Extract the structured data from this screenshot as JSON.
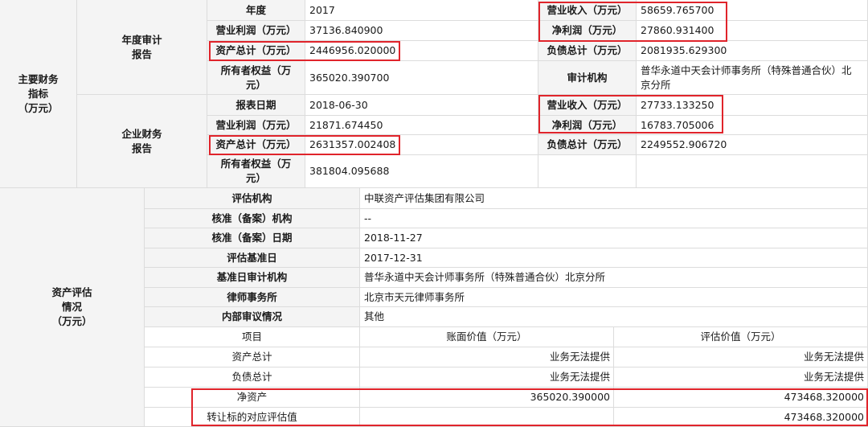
{
  "section_main": "主要财务\n指标\n（万元）",
  "annual": {
    "group": "年度审计\n报告",
    "year_label": "年度",
    "year": "2017",
    "revenue_label": "营业收入（万元）",
    "revenue": "58659.765700",
    "op_profit_label": "营业利润（万元）",
    "op_profit": "37136.840900",
    "net_profit_label": "净利润（万元）",
    "net_profit": "27860.931400",
    "assets_label": "资产总计（万元）",
    "assets": "2446956.020000",
    "liab_label": "负债总计（万元）",
    "liab": "2081935.629300",
    "equity_label": "所有者权益（万\n元）",
    "equity": "365020.390700",
    "auditor_label": "审计机构",
    "auditor": "普华永道中天会计师事务所（特殊普通合伙）北\n京分所"
  },
  "enterprise": {
    "group": "企业财务\n报告",
    "date_label": "报表日期",
    "date": "2018-06-30",
    "revenue_label": "营业收入（万元）",
    "revenue": "27733.133250",
    "op_profit_label": "营业利润（万元）",
    "op_profit": "21871.674450",
    "net_profit_label": "净利润（万元）",
    "net_profit": "16783.705006",
    "assets_label": "资产总计（万元）",
    "assets": "2631357.002408",
    "liab_label": "负债总计（万元）",
    "liab": "2249552.906720",
    "equity_label": "所有者权益（万\n元）",
    "equity": "381804.095688"
  },
  "section_eval": "资产评估\n情况\n（万元）",
  "evaluation": {
    "agency_label": "评估机构",
    "agency": "中联资产评估集团有限公司",
    "approval_agency_label": "核准（备案）机构",
    "approval_agency": "--",
    "approval_date_label": "核准（备案）日期",
    "approval_date": "2018-11-27",
    "base_date_label": "评估基准日",
    "base_date": "2017-12-31",
    "base_auditor_label": "基准日审计机构",
    "base_auditor": "普华永道中天会计师事务所（特殊普通合伙）北京分所",
    "law_firm_label": "律师事务所",
    "law_firm": "北京市天元律师事务所",
    "review_label": "内部审议情况",
    "review": "其他"
  },
  "eval_table": {
    "headers": [
      "项目",
      "账面价值（万元）",
      "评估价值（万元）"
    ],
    "rows": [
      [
        "资产总计",
        "业务无法提供",
        "业务无法提供"
      ],
      [
        "负债总计",
        "业务无法提供",
        "业务无法提供"
      ],
      [
        "净资产",
        "365020.390000",
        "473468.320000"
      ],
      [
        "转让标的对应评估值",
        "",
        "473468.320000"
      ]
    ]
  },
  "highlight_color": "#e0242b"
}
